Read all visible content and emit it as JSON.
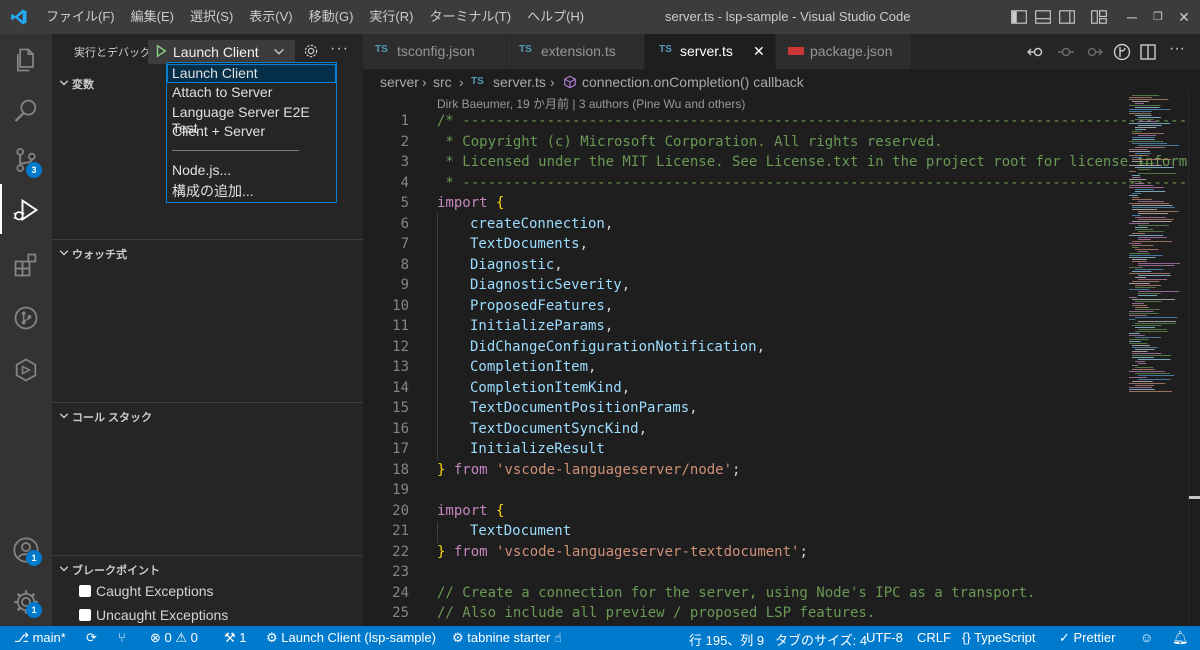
{
  "window": {
    "title": "server.ts - lsp-sample - Visual Studio Code",
    "menu": [
      "ファイル(F)",
      "編集(E)",
      "選択(S)",
      "表示(V)",
      "移動(G)",
      "実行(R)",
      "ターミナル(T)",
      "ヘルプ(H)"
    ]
  },
  "activity": {
    "scm_badge": "3",
    "accounts_badge": "1",
    "settings_badge": "1"
  },
  "debug": {
    "label": "実行とデバッグ",
    "selected_config": "Launch Client",
    "options": [
      "Launch Client",
      "Attach to Server",
      "Language Server E2E Test",
      "Client + Server",
      "Node.js...",
      "構成の追加..."
    ]
  },
  "sidebar": {
    "variables": "変数",
    "watch": "ウォッチ式",
    "callstack": "コール スタック",
    "breakpoints": "ブレークポイント",
    "bp_items": [
      "Caught Exceptions",
      "Uncaught Exceptions"
    ]
  },
  "tabs": [
    {
      "icon": "TS",
      "label": "tsconfig.json"
    },
    {
      "icon": "TS",
      "label": "extension.ts"
    },
    {
      "icon": "TS",
      "label": "server.ts",
      "close": "✕"
    },
    {
      "icon": "",
      "label": "package.json"
    }
  ],
  "breadcrumb": {
    "parts": [
      "server",
      "src",
      "TS",
      "server.ts",
      "connection.onCompletion() callback"
    ]
  },
  "blame": "Dirk Baeumer, 19 か月前 | 3 authors (Pine Wu and others)",
  "code": {
    "line_numbers": [
      "1",
      "2",
      "3",
      "4",
      "5",
      "6",
      "7",
      "8",
      "9",
      "10",
      "11",
      "12",
      "13",
      "14",
      "15",
      "16",
      "17",
      "18",
      "19",
      "20",
      "21",
      "22",
      "23",
      "24",
      "25"
    ],
    "l1": "/* ------------------------------------------------------------------------------------------",
    "l2": " * Copyright (c) Microsoft Corporation. All rights reserved.",
    "l3": " * Licensed under the MIT License. See License.txt in the project root for license information.",
    "l4": " * ------------------------------------------------------------------------------------------",
    "kw_import": "import",
    "brace_open": " {",
    "brace_close": "}",
    "kw_from": "from",
    "imports1": [
      "createConnection",
      "TextDocuments",
      "Diagnostic",
      "DiagnosticSeverity",
      "ProposedFeatures",
      "InitializeParams",
      "DidChangeConfigurationNotification",
      "CompletionItem",
      "CompletionItemKind",
      "TextDocumentPositionParams",
      "TextDocumentSyncKind",
      "InitializeResult"
    ],
    "module1": "'vscode-languageserver/node'",
    "imports2": [
      "TextDocument"
    ],
    "module2": "'vscode-languageserver-textdocument'",
    "l24": "// Create a connection for the server, using Node's IPC as a transport.",
    "l25": "// Also include all preview / proposed LSP features."
  },
  "status": {
    "branch": "main*",
    "errors": "0",
    "warnings": "0",
    "ports": "1",
    "debug": "Launch Client (lsp-sample)",
    "tabnine": "tabnine starter",
    "position": "行 195、列 9",
    "tabsize": "タブのサイズ: 4",
    "encoding": "UTF-8",
    "eol": "CRLF",
    "language": "TypeScript",
    "prettier": "Prettier"
  },
  "colors": {
    "accent": "#007acc",
    "titlebar": "#3c3c3c",
    "editor_bg": "#1e1e1e"
  }
}
